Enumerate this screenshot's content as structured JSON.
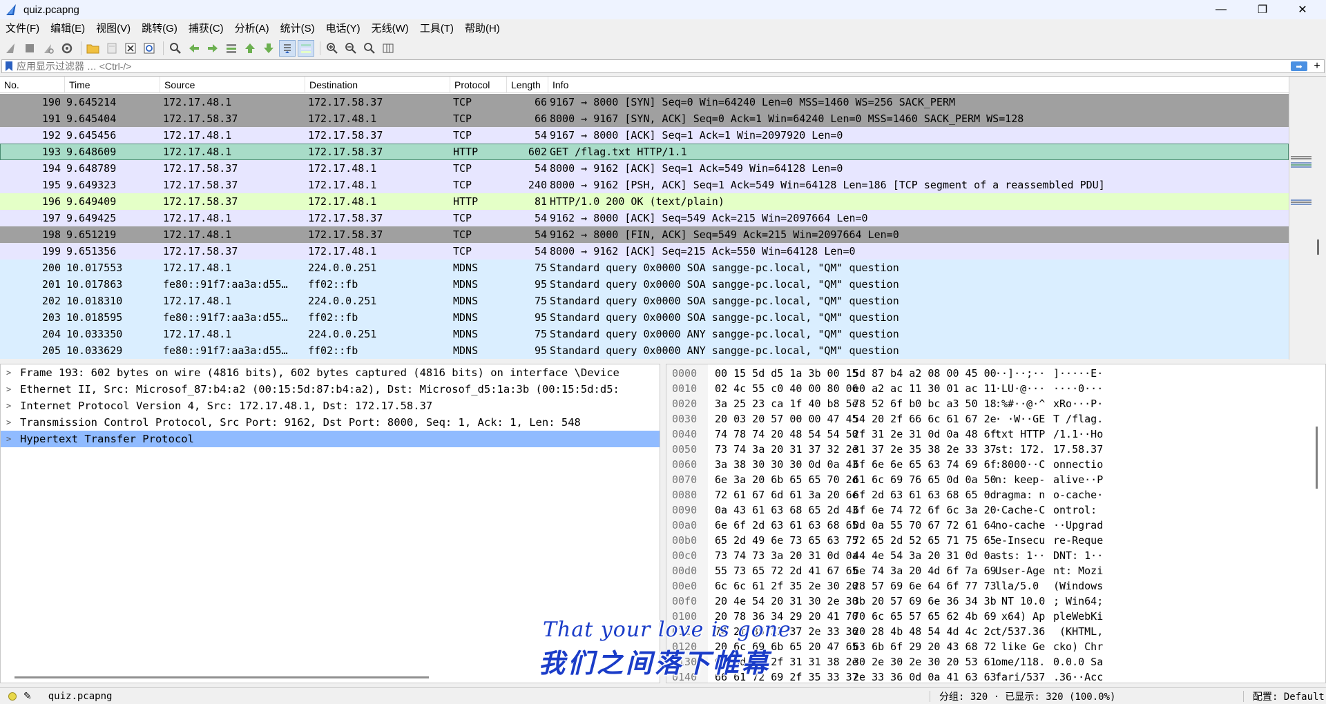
{
  "window": {
    "title": "quiz.pcapng",
    "minimize": "—",
    "maximize": "❐",
    "close": "✕"
  },
  "menu": [
    "文件(F)",
    "编辑(E)",
    "视图(V)",
    "跳转(G)",
    "捕获(C)",
    "分析(A)",
    "统计(S)",
    "电话(Y)",
    "无线(W)",
    "工具(T)",
    "帮助(H)"
  ],
  "filter": {
    "placeholder": "应用显示过滤器 … <Ctrl-/>",
    "apply_glyph": "➡",
    "add_glyph": "+"
  },
  "packet_list": {
    "columns": [
      "No.",
      "Time",
      "Source",
      "Destination",
      "Protocol",
      "Length",
      "Info"
    ],
    "rows": [
      {
        "no": "190",
        "time": "9.645214",
        "src": "172.17.48.1",
        "dst": "172.17.58.37",
        "proto": "TCP",
        "len": "66",
        "info": "9167 → 8000 [SYN] Seq=0 Win=64240 Len=0 MSS=1460 WS=256 SACK_PERM",
        "style": "tcp-grey"
      },
      {
        "no": "191",
        "time": "9.645404",
        "src": "172.17.58.37",
        "dst": "172.17.48.1",
        "proto": "TCP",
        "len": "66",
        "info": "8000 → 9167 [SYN, ACK] Seq=0 Ack=1 Win=64240 Len=0 MSS=1460 SACK_PERM WS=128",
        "style": "tcp-grey"
      },
      {
        "no": "192",
        "time": "9.645456",
        "src": "172.17.48.1",
        "dst": "172.17.58.37",
        "proto": "TCP",
        "len": "54",
        "info": "9167 → 8000 [ACK] Seq=1 Ack=1 Win=2097920 Len=0",
        "style": "tcp"
      },
      {
        "no": "193",
        "time": "9.648609",
        "src": "172.17.48.1",
        "dst": "172.17.58.37",
        "proto": "HTTP",
        "len": "602",
        "info": "GET /flag.txt HTTP/1.1",
        "style": "http-sel"
      },
      {
        "no": "194",
        "time": "9.648789",
        "src": "172.17.58.37",
        "dst": "172.17.48.1",
        "proto": "TCP",
        "len": "54",
        "info": "8000 → 9162 [ACK] Seq=1 Ack=549 Win=64128 Len=0",
        "style": "tcp"
      },
      {
        "no": "195",
        "time": "9.649323",
        "src": "172.17.58.37",
        "dst": "172.17.48.1",
        "proto": "TCP",
        "len": "240",
        "info": "8000 → 9162 [PSH, ACK] Seq=1 Ack=549 Win=64128 Len=186 [TCP segment of a reassembled PDU]",
        "style": "tcp"
      },
      {
        "no": "196",
        "time": "9.649409",
        "src": "172.17.58.37",
        "dst": "172.17.48.1",
        "proto": "HTTP",
        "len": "81",
        "info": "HTTP/1.0 200 OK  (text/plain)",
        "style": "http"
      },
      {
        "no": "197",
        "time": "9.649425",
        "src": "172.17.48.1",
        "dst": "172.17.58.37",
        "proto": "TCP",
        "len": "54",
        "info": "9162 → 8000 [ACK] Seq=549 Ack=215 Win=2097664 Len=0",
        "style": "tcp"
      },
      {
        "no": "198",
        "time": "9.651219",
        "src": "172.17.48.1",
        "dst": "172.17.58.37",
        "proto": "TCP",
        "len": "54",
        "info": "9162 → 8000 [FIN, ACK] Seq=549 Ack=215 Win=2097664 Len=0",
        "style": "tcp-grey"
      },
      {
        "no": "199",
        "time": "9.651356",
        "src": "172.17.58.37",
        "dst": "172.17.48.1",
        "proto": "TCP",
        "len": "54",
        "info": "8000 → 9162 [ACK] Seq=215 Ack=550 Win=64128 Len=0",
        "style": "tcp"
      },
      {
        "no": "200",
        "time": "10.017553",
        "src": "172.17.48.1",
        "dst": "224.0.0.251",
        "proto": "MDNS",
        "len": "75",
        "info": "Standard query 0x0000 SOA sangge-pc.local, \"QM\" question",
        "style": "mdns"
      },
      {
        "no": "201",
        "time": "10.017863",
        "src": "fe80::91f7:aa3a:d55…",
        "dst": "ff02::fb",
        "proto": "MDNS",
        "len": "95",
        "info": "Standard query 0x0000 SOA sangge-pc.local, \"QM\" question",
        "style": "mdns"
      },
      {
        "no": "202",
        "time": "10.018310",
        "src": "172.17.48.1",
        "dst": "224.0.0.251",
        "proto": "MDNS",
        "len": "75",
        "info": "Standard query 0x0000 SOA sangge-pc.local, \"QM\" question",
        "style": "mdns"
      },
      {
        "no": "203",
        "time": "10.018595",
        "src": "fe80::91f7:aa3a:d55…",
        "dst": "ff02::fb",
        "proto": "MDNS",
        "len": "95",
        "info": "Standard query 0x0000 SOA sangge-pc.local, \"QM\" question",
        "style": "mdns"
      },
      {
        "no": "204",
        "time": "10.033350",
        "src": "172.17.48.1",
        "dst": "224.0.0.251",
        "proto": "MDNS",
        "len": "75",
        "info": "Standard query 0x0000 ANY sangge-pc.local, \"QM\" question",
        "style": "mdns"
      },
      {
        "no": "205",
        "time": "10.033629",
        "src": "fe80::91f7:aa3a:d55…",
        "dst": "ff02::fb",
        "proto": "MDNS",
        "len": "95",
        "info": "Standard query 0x0000 ANY sangge-pc.local, \"QM\" question",
        "style": "mdns"
      }
    ]
  },
  "details": {
    "rows": [
      {
        "text": "Frame 193: 602 bytes on wire (4816 bits), 602 bytes captured (4816 bits) on interface \\Device",
        "selected": false
      },
      {
        "text": "Ethernet II, Src: Microsof_87:b4:a2 (00:15:5d:87:b4:a2), Dst: Microsof_d5:1a:3b (00:15:5d:d5:",
        "selected": false
      },
      {
        "text": "Internet Protocol Version 4, Src: 172.17.48.1, Dst: 172.17.58.37",
        "selected": false
      },
      {
        "text": "Transmission Control Protocol, Src Port: 9162, Dst Port: 8000, Seq: 1, Ack: 1, Len: 548",
        "selected": false
      },
      {
        "text": "Hypertext Transfer Protocol",
        "selected": true
      }
    ],
    "expander": ">"
  },
  "bytes": {
    "rows": [
      {
        "off": "0000",
        "h1": "00 15 5d d5 1a 3b 00 15",
        "h2": "5d 87 b4 a2 08 00 45 00",
        "a1": "··]··;··",
        "a2": "]·····E·"
      },
      {
        "off": "0010",
        "h1": "02 4c 55 c0 40 00 80 06",
        "h2": "e0 a2 ac 11 30 01 ac 11",
        "a1": "·LU·@···",
        "a2": "····0···"
      },
      {
        "off": "0020",
        "h1": "3a 25 23 ca 1f 40 b8 5e",
        "h2": "78 52 6f b0 bc a3 50 18",
        "a1": ":%#··@·^",
        "a2": "xRo···P·"
      },
      {
        "off": "0030",
        "h1": "20 03 20 57 00 00 47 45",
        "h2": "54 20 2f 66 6c 61 67 2e",
        "a1": "· ·W··GE",
        "a2": "T /flag."
      },
      {
        "off": "0040",
        "h1": "74 78 74 20 48 54 54 50",
        "h2": "2f 31 2e 31 0d 0a 48 6f",
        "a1": "txt HTTP",
        "a2": "/1.1··Ho"
      },
      {
        "off": "0050",
        "h1": "73 74 3a 20 31 37 32 2e",
        "h2": "31 37 2e 35 38 2e 33 37",
        "a1": "st: 172.",
        "a2": "17.58.37"
      },
      {
        "off": "0060",
        "h1": "3a 38 30 30 30 0d 0a 43",
        "h2": "6f 6e 6e 65 63 74 69 6f",
        "a1": ":8000··C",
        "a2": "onnectio"
      },
      {
        "off": "0070",
        "h1": "6e 3a 20 6b 65 65 70 2d",
        "h2": "61 6c 69 76 65 0d 0a 50",
        "a1": "n: keep-",
        "a2": "alive··P"
      },
      {
        "off": "0080",
        "h1": "72 61 67 6d 61 3a 20 6e",
        "h2": "6f 2d 63 61 63 68 65 0d",
        "a1": "ragma: n",
        "a2": "o-cache·"
      },
      {
        "off": "0090",
        "h1": "0a 43 61 63 68 65 2d 43",
        "h2": "6f 6e 74 72 6f 6c 3a 20",
        "a1": "·Cache-C",
        "a2": "ontrol: "
      },
      {
        "off": "00a0",
        "h1": "6e 6f 2d 63 61 63 68 65",
        "h2": "0d 0a 55 70 67 72 61 64",
        "a1": "no-cache",
        "a2": "··Upgrad"
      },
      {
        "off": "00b0",
        "h1": "65 2d 49 6e 73 65 63 75",
        "h2": "72 65 2d 52 65 71 75 65",
        "a1": "e-Insecu",
        "a2": "re-Reque"
      },
      {
        "off": "00c0",
        "h1": "73 74 73 3a 20 31 0d 0a",
        "h2": "44 4e 54 3a 20 31 0d 0a",
        "a1": "sts: 1··",
        "a2": "DNT: 1··"
      },
      {
        "off": "00d0",
        "h1": "55 73 65 72 2d 41 67 65",
        "h2": "6e 74 3a 20 4d 6f 7a 69",
        "a1": "User-Age",
        "a2": "nt: Mozi"
      },
      {
        "off": "00e0",
        "h1": "6c 6c 61 2f 35 2e 30 20",
        "h2": "28 57 69 6e 64 6f 77 73",
        "a1": "lla/5.0 ",
        "a2": "(Windows"
      },
      {
        "off": "00f0",
        "h1": "20 4e 54 20 31 30 2e 30",
        "h2": "3b 20 57 69 6e 36 34 3b",
        "a1": " NT 10.0",
        "a2": "; Win64;"
      },
      {
        "off": "0100",
        "h1": "20 78 36 34 29 20 41 70",
        "h2": "70 6c 65 57 65 62 4b 69",
        "a1": " x64) Ap",
        "a2": "pleWebKi"
      },
      {
        "off": "0110",
        "h1": "74 2f 35 33 37 2e 33 36",
        "h2": "20 28 4b 48 54 4d 4c 2c",
        "a1": "t/537.36",
        "a2": " (KHTML,"
      },
      {
        "off": "0120",
        "h1": "20 6c 69 6b 65 20 47 65",
        "h2": "63 6b 6f 29 20 43 68 72",
        "a1": " like Ge",
        "a2": "cko) Chr"
      },
      {
        "off": "0130",
        "h1": "6f 6d 65 2f 31 31 38 2e",
        "h2": "30 2e 30 2e 30 20 53 61",
        "a1": "ome/118.",
        "a2": "0.0.0 Sa"
      },
      {
        "off": "0140",
        "h1": "66 61 72 69 2f 35 33 37",
        "h2": "2e 33 36 0d 0a 41 63 63",
        "a1": "fari/537",
        "a2": ".36··Acc"
      }
    ]
  },
  "overlay": {
    "line1": "That your love is gone",
    "line2": "我们之间落下帷幕"
  },
  "status": {
    "file": "quiz.pcapng",
    "stats": "分组: 320 · 已显示: 320 (100.0%)",
    "profile": "配置: Default"
  },
  "colors": {
    "tcp_grey": "#a0a0a0",
    "tcp": "#e7e6ff",
    "http_selected": "#a8dcc8",
    "http": "#e4ffc7",
    "mdns": "#daeeff",
    "detail_selected": "#90bbff",
    "overlay_text": "#1a3cc8"
  }
}
